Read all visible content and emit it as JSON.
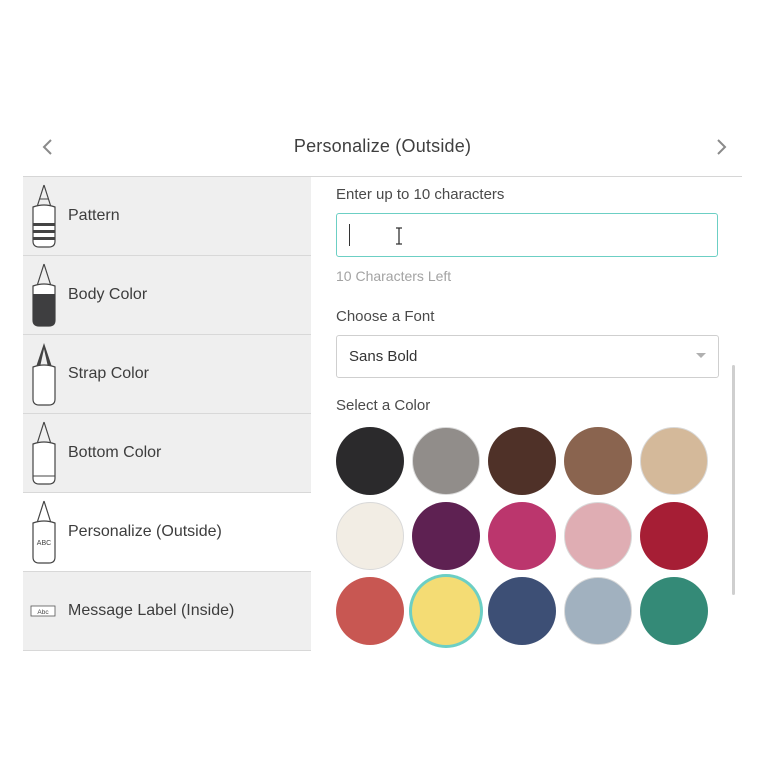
{
  "header": {
    "title": "Personalize (Outside)"
  },
  "sidebar": {
    "items": [
      {
        "label": "Pattern",
        "icon": "bag-pattern-icon"
      },
      {
        "label": "Body Color",
        "icon": "bag-body-color-icon"
      },
      {
        "label": "Strap Color",
        "icon": "bag-strap-color-icon"
      },
      {
        "label": "Bottom Color",
        "icon": "bag-bottom-color-icon"
      },
      {
        "label": "Personalize (Outside)",
        "icon": "bag-personalize-icon",
        "icon_text": "ABC",
        "active": true
      },
      {
        "label": "Message Label (Inside)",
        "icon": "message-label-icon",
        "icon_text": "Abc"
      }
    ]
  },
  "personalize": {
    "input_label": "Enter up to 10 characters",
    "input_value": "",
    "chars_left": "10 Characters Left",
    "font_label": "Choose a Font",
    "font_selected": "Sans Bold",
    "color_label": "Select a Color",
    "colors": [
      "#2b2a2c",
      "#918d8a",
      "#4f3128",
      "#8a644f",
      "#d4b99a",
      "#f2ede4",
      "#5e2152",
      "#bb366d",
      "#dfadb3",
      "#a61e35",
      "#c85752",
      "#f4dc74",
      "#3d4f75",
      "#a1b1bf",
      "#348a77"
    ],
    "selected_color": "#f4dc74"
  }
}
